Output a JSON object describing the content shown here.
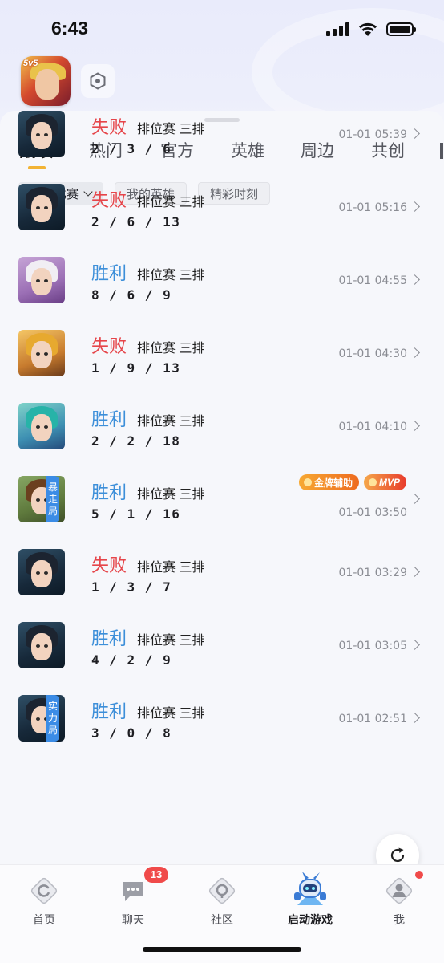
{
  "status_bar": {
    "time": "6:43"
  },
  "header": {
    "app_icon_text": "5v5"
  },
  "tabs": [
    {
      "label": "战绩",
      "active": true
    },
    {
      "label": "热门",
      "active": false
    },
    {
      "label": "官方",
      "active": false
    },
    {
      "label": "英雄",
      "active": false
    },
    {
      "label": "周边",
      "active": false
    },
    {
      "label": "共创",
      "active": false
    }
  ],
  "filters": [
    {
      "label": "全部比赛",
      "active": true
    },
    {
      "label": "我的英雄",
      "active": false
    },
    {
      "label": "精彩时刻",
      "active": false
    }
  ],
  "matches": [
    {
      "result": "失败",
      "outcome": "loss",
      "mode": "排位赛 三排",
      "kda": "2/3/6",
      "time": "01-01 05:39",
      "hero": "dark-hair"
    },
    {
      "result": "失败",
      "outcome": "loss",
      "mode": "排位赛 三排",
      "kda": "2/6/13",
      "time": "01-01 05:16",
      "hero": "dark-hair"
    },
    {
      "result": "胜利",
      "outcome": "win",
      "mode": "排位赛 三排",
      "kda": "8/6/9",
      "time": "01-01 04:55",
      "hero": "white-hair"
    },
    {
      "result": "失败",
      "outcome": "loss",
      "mode": "排位赛 三排",
      "kda": "1/9/13",
      "time": "01-01 04:30",
      "hero": "blonde"
    },
    {
      "result": "胜利",
      "outcome": "win",
      "mode": "排位赛 三排",
      "kda": "2/2/18",
      "time": "01-01 04:10",
      "hero": "teal-hair"
    },
    {
      "result": "胜利",
      "outcome": "win",
      "mode": "排位赛 三排",
      "kda": "5/1/16",
      "time": "01-01 03:50",
      "hero": "brown-boy",
      "badge": "暴走局",
      "honors": [
        "金牌辅助",
        "MVP"
      ]
    },
    {
      "result": "失败",
      "outcome": "loss",
      "mode": "排位赛 三排",
      "kda": "1/3/7",
      "time": "01-01 03:29",
      "hero": "dark-hair"
    },
    {
      "result": "胜利",
      "outcome": "win",
      "mode": "排位赛 三排",
      "kda": "4/2/9",
      "time": "01-01 03:05",
      "hero": "dark-hair"
    },
    {
      "result": "胜利",
      "outcome": "win",
      "mode": "排位赛 三排",
      "kda": "3/0/8",
      "time": "01-01 02:51",
      "hero": "dark-hair",
      "badge": "实力局"
    }
  ],
  "tabbar": {
    "items": [
      {
        "label": "首页",
        "icon": "home-icon"
      },
      {
        "label": "聊天",
        "icon": "chat-icon",
        "count": "13"
      },
      {
        "label": "社区",
        "icon": "community-icon"
      },
      {
        "label": "启动游戏",
        "icon": "launch-game-icon",
        "active": true
      },
      {
        "label": "我",
        "icon": "profile-icon",
        "dot": true
      }
    ]
  },
  "colors": {
    "loss": "#e6454a",
    "win": "#3d8fd9",
    "accent": "#f2b334",
    "badge": "#3b8ce6"
  }
}
